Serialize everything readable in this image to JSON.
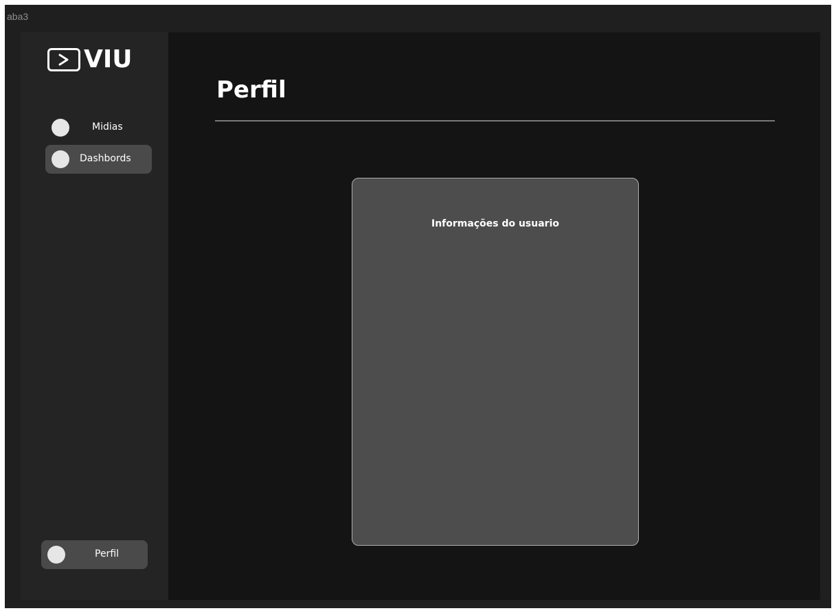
{
  "window": {
    "frame_label": "aba3"
  },
  "logo": {
    "text": "VIU",
    "icon": "play-chevron-icon"
  },
  "sidebar": {
    "items": [
      {
        "label": "Midias",
        "icon": "circle-icon",
        "active": false
      },
      {
        "label": "Dashbords",
        "icon": "circle-icon",
        "active": true
      }
    ],
    "footer_item": {
      "label": "Perfil",
      "icon": "circle-icon",
      "active": true
    }
  },
  "main": {
    "title": "Perfil",
    "card": {
      "title": "Informações do usuario"
    }
  },
  "colors": {
    "frame_bg": "#1f1f1f",
    "sidebar_bg": "#242424",
    "main_bg": "#141414",
    "card_bg": "#4d4d4d",
    "active_item_bg": "#4a4a4a",
    "text": "#ffffff"
  }
}
